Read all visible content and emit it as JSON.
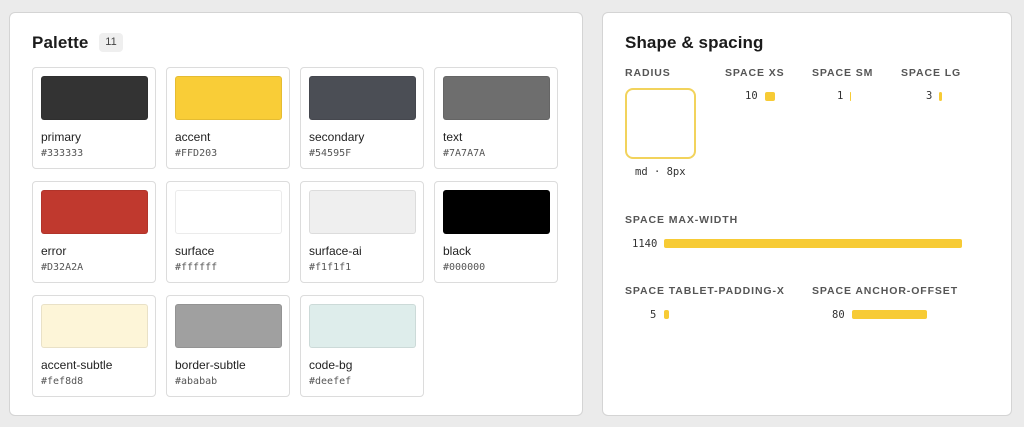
{
  "palette": {
    "title": "Palette",
    "count": "11",
    "swatches": [
      {
        "name": "primary",
        "hex": "#333333",
        "color": "#333333"
      },
      {
        "name": "accent",
        "hex": "#FFD203",
        "color": "#F9CD37"
      },
      {
        "name": "secondary",
        "hex": "#54595F",
        "color": "#4b4e55"
      },
      {
        "name": "text",
        "hex": "#7A7A7A",
        "color": "#6e6e6e"
      },
      {
        "name": "error",
        "hex": "#D32A2A",
        "color": "#c0392e"
      },
      {
        "name": "surface",
        "hex": "#ffffff",
        "color": "#ffffff"
      },
      {
        "name": "surface-ai",
        "hex": "#f1f1f1",
        "color": "#efefef"
      },
      {
        "name": "black",
        "hex": "#000000",
        "color": "#000000"
      },
      {
        "name": "accent-subtle",
        "hex": "#fef8d8",
        "color": "#fdf5d8"
      },
      {
        "name": "border-subtle",
        "hex": "#ababab",
        "color": "#a0a0a0"
      },
      {
        "name": "code-bg",
        "hex": "#deefef",
        "color": "#deedeb"
      }
    ]
  },
  "shape": {
    "title": "Shape & spacing",
    "radius": {
      "label": "RADIUS",
      "caption": "md · 8px"
    },
    "space_xs": {
      "label": "SPACE XS",
      "value": "10"
    },
    "space_sm": {
      "label": "SPACE SM",
      "value": "1"
    },
    "space_lg": {
      "label": "SPACE LG",
      "value": "3"
    },
    "space_max_width": {
      "label": "SPACE MAX-WIDTH",
      "value": "1140"
    },
    "space_tablet_padding_x": {
      "label": "SPACE TABLET-PADDING-X",
      "value": "5"
    },
    "space_anchor_offset": {
      "label": "SPACE ANCHOR-OFFSET",
      "value": "80"
    }
  },
  "colors": {
    "bar": "#f7cb35",
    "radius_border": "#f2d35c",
    "page_bg": "#ebebeb"
  }
}
